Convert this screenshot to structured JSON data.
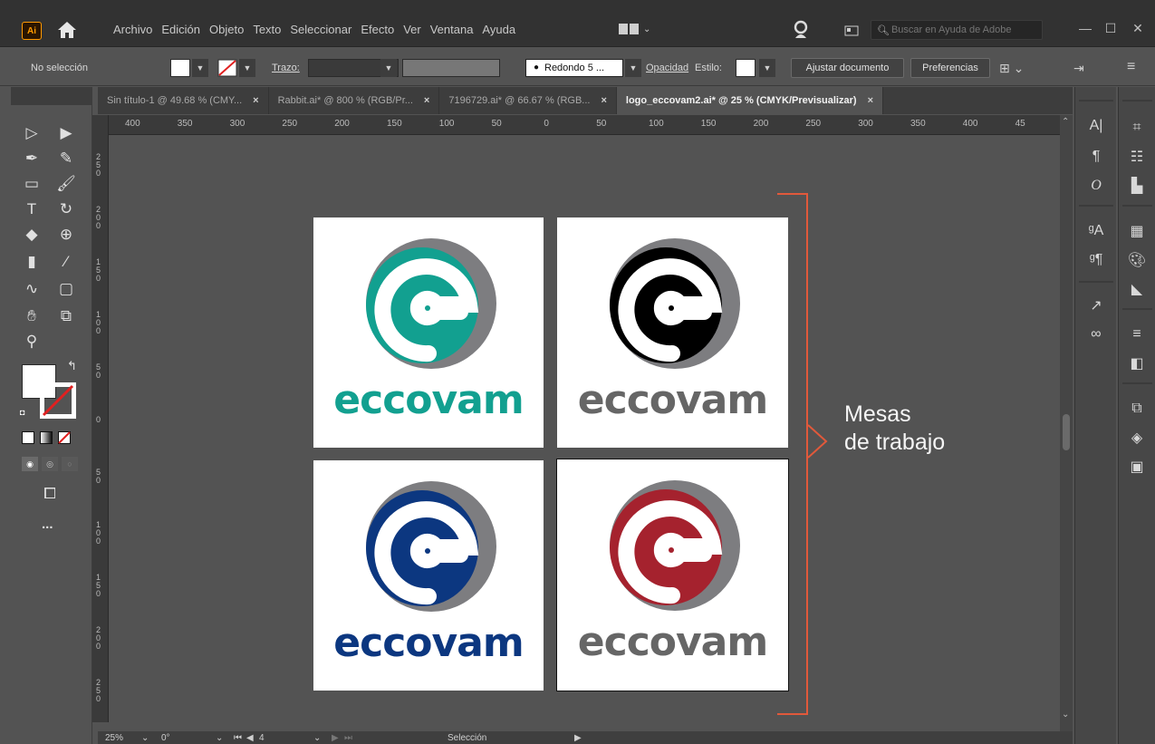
{
  "app": {
    "logo_text": "Ai"
  },
  "menu": [
    "Archivo",
    "Edición",
    "Objeto",
    "Texto",
    "Seleccionar",
    "Efecto",
    "Ver",
    "Ventana",
    "Ayuda"
  ],
  "search": {
    "placeholder": "Buscar en Ayuda de Adobe"
  },
  "control_bar": {
    "selection_label": "No selección",
    "stroke_label": "Trazo:",
    "brush_label": "Redondo 5 ...",
    "opacity_label": "Opacidad",
    "style_label": "Estilo:",
    "fit_document": "Ajustar documento",
    "preferences": "Preferencias"
  },
  "tabs": [
    {
      "label": "Sin título-1 @ 49.68 % (CMY...",
      "close": "×"
    },
    {
      "label": "Rabbit.ai* @ 800 % (RGB/Pr...",
      "close": "×"
    },
    {
      "label": "7196729.ai* @ 66.67 % (RGB...",
      "close": "×"
    },
    {
      "label": "logo_eccovam2.ai* @ 25 % (CMYK/Previsualizar)",
      "close": "×"
    }
  ],
  "ruler": {
    "top": [
      "400",
      "350",
      "300",
      "250",
      "200",
      "150",
      "100",
      "50",
      "0",
      "50",
      "100",
      "150",
      "200",
      "250",
      "300",
      "350",
      "400",
      "45"
    ],
    "left": [
      "250",
      "200",
      "150",
      "100",
      "50",
      "0",
      "50",
      "100",
      "150",
      "200",
      "250"
    ]
  },
  "artboards": [
    {
      "word": "eccovam",
      "primary": "#12a090",
      "word_color": "#12a090"
    },
    {
      "word": "eccovam",
      "primary": "#000000",
      "word_color": "#666666"
    },
    {
      "word": "eccovam",
      "primary": "#0c3780",
      "word_color": "#0c3780"
    },
    {
      "word": "eccovam",
      "primary": "#a5222e",
      "word_color": "#666666"
    }
  ],
  "logo_ring_color": "#7d7d80",
  "annotation": {
    "line1": "Mesas",
    "line2": "de trabajo",
    "bracket_color": "#e1593b"
  },
  "status_bar": {
    "zoom": "25%",
    "rotation": "0°",
    "artboard_num": "4",
    "mode": "Selección"
  },
  "toolbar_more": "..."
}
